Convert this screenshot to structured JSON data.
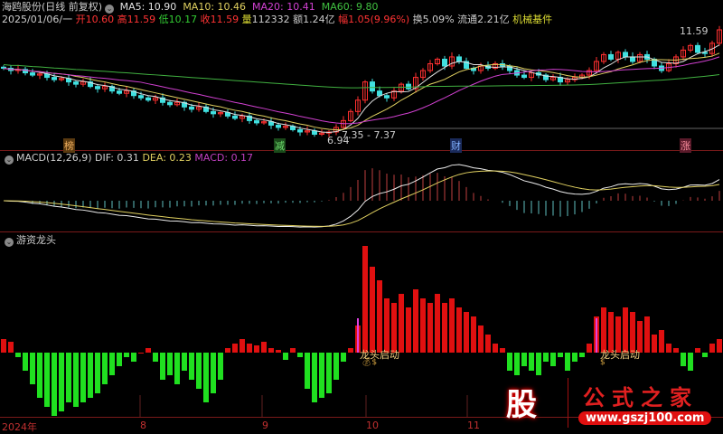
{
  "header": {
    "stock": "海鸥股份(日线 前复权)",
    "ma5": "MA5: 10.90",
    "ma10": "MA10: 10.46",
    "ma20": "MA20: 10.41",
    "ma60": "MA60: 9.80",
    "date": "2025/01/06/一",
    "open_l": "开",
    "open": "10.60",
    "high_l": "高",
    "high": "11.59",
    "low_l": "低",
    "low": "10.17",
    "close_l": "收",
    "close": "11.59",
    "vol_l": "量",
    "vol": "112332",
    "amt": "额1.24亿",
    "chg_l": "幅",
    "chg": "1.05(9.96%)",
    "turn": "换5.09%",
    "float": "流通2.21亿",
    "sector": "机械基件"
  },
  "main": {
    "high_label": "11.59",
    "low_label": "6.94",
    "range_label": "7.35 - 7.37",
    "markers": [
      {
        "text": "榜",
        "color": "#d08a30"
      },
      {
        "text": "减",
        "color": "#40a040"
      },
      {
        "text": "财",
        "color": "#4080d0"
      },
      {
        "text": "涨",
        "color": "#d05060"
      }
    ]
  },
  "macd": {
    "title": "MACD(12,26,9)",
    "dif": "DIF: 0.31",
    "dea": "DEA: 0.23",
    "macd": "MACD: 0.17"
  },
  "indicator": {
    "title": "游资龙头",
    "signal": "龙头启动",
    "signal_bars": [
      49,
      82
    ]
  },
  "xaxis": [
    "2024年",
    "8",
    "9",
    "10",
    "11"
  ],
  "watermark": {
    "logo": "股",
    "name": "公式之家",
    "url": "www.gszj100.com"
  },
  "colors": {
    "up": "#ff3030",
    "down": "#40e0e0",
    "ma5": "#e0e0e0",
    "ma10": "#e0d060",
    "ma20": "#d040d0",
    "ma60": "#40b040",
    "bar_up": "#e01010",
    "bar_down": "#20e020"
  },
  "closes": [
    9.9,
    9.8,
    9.85,
    9.7,
    9.6,
    9.65,
    9.5,
    9.4,
    9.45,
    9.3,
    9.2,
    9.3,
    9.1,
    9.0,
    9.1,
    8.9,
    8.8,
    8.9,
    8.7,
    8.6,
    8.5,
    8.6,
    8.4,
    8.3,
    8.4,
    8.2,
    8.1,
    8.2,
    8.0,
    7.9,
    7.95,
    7.8,
    7.7,
    7.8,
    7.6,
    7.5,
    7.55,
    7.4,
    7.3,
    7.35,
    7.2,
    7.1,
    7.15,
    7.0,
    7.05,
    7.1,
    7.3,
    7.6,
    8.0,
    8.5,
    9.3,
    8.9,
    8.7,
    8.6,
    8.9,
    9.2,
    9.0,
    9.5,
    9.8,
    10.1,
    10.3,
    10.0,
    10.4,
    10.2,
    9.9,
    9.8,
    10.0,
    9.9,
    10.1,
    10.0,
    9.8,
    9.6,
    9.5,
    9.7,
    9.6,
    9.4,
    9.5,
    9.3,
    9.4,
    9.5,
    9.6,
    9.8,
    10.2,
    10.5,
    10.3,
    10.6,
    10.4,
    10.2,
    10.5,
    10.3,
    10.0,
    9.8,
    10.1,
    10.4,
    10.7,
    10.9,
    10.6,
    10.55,
    11.0,
    11.59
  ],
  "dragon": [
    15,
    12,
    -5,
    -20,
    -35,
    -50,
    -60,
    -70,
    -65,
    -55,
    -60,
    -55,
    -50,
    -45,
    -35,
    -25,
    -15,
    -5,
    -10,
    0,
    5,
    -10,
    -30,
    -25,
    -35,
    -20,
    -30,
    -40,
    -55,
    -45,
    -30,
    5,
    10,
    15,
    10,
    8,
    12,
    5,
    3,
    -8,
    5,
    -5,
    -40,
    -55,
    -50,
    -45,
    -30,
    -10,
    5,
    30,
    118,
    95,
    80,
    60,
    55,
    65,
    50,
    70,
    60,
    55,
    65,
    55,
    60,
    50,
    45,
    40,
    30,
    20,
    10,
    5,
    -20,
    -25,
    -15,
    -20,
    -25,
    -10,
    -15,
    -5,
    -20,
    -10,
    -5,
    10,
    40,
    50,
    45,
    40,
    50,
    45,
    35,
    40,
    20,
    25,
    10,
    5,
    -15,
    -20,
    5,
    -5,
    10,
    15
  ]
}
